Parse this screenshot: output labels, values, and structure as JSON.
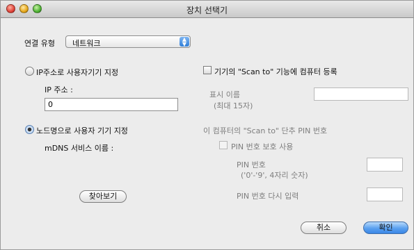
{
  "window": {
    "title": "장치 선택기"
  },
  "connection": {
    "label": "연결 유형",
    "value": "네트워크"
  },
  "ip_option": {
    "label": "IP주소로 사용자기기 지정",
    "ip_label": "IP 주소 :",
    "ip_value": "0"
  },
  "node_option": {
    "label": "노드명으로 사용자 기기 지정",
    "mdns_label": "mDNS 서비스 이름 :",
    "browse_button": "찾아보기"
  },
  "scan_to": {
    "register_label": "기기의 \"Scan to\" 기능에 컴퓨터 등록",
    "display_name_label": "표시 이름",
    "display_name_hint": "(최대 15자)",
    "display_name_value": "",
    "pin_section_title": "이 컴퓨터의 \"Scan to\" 단추 PIN 번호",
    "pin_protect_label": "PIN 번호 보호 사용",
    "pin_label": "PIN 번호",
    "pin_hint": "('0'-'9', 4자리 숫자)",
    "pin_value": "",
    "pin_repeat_label": "PIN 번호 다시 입력",
    "pin_repeat_value": ""
  },
  "buttons": {
    "cancel": "취소",
    "ok": "확인"
  }
}
